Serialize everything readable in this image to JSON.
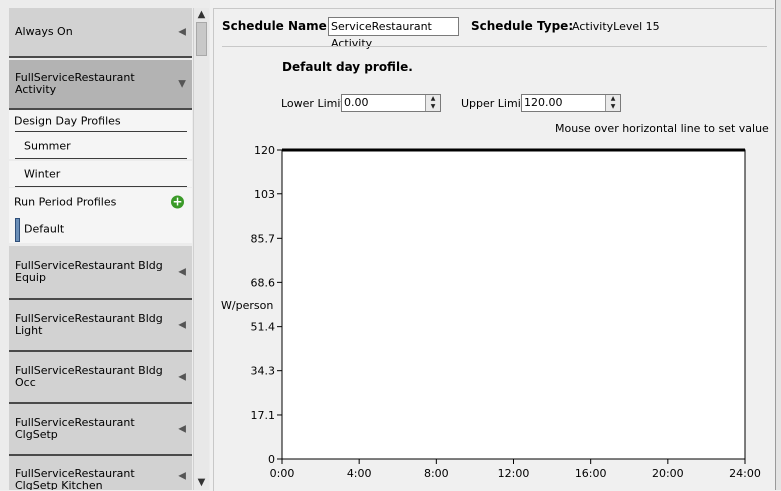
{
  "sidebar": {
    "items_top": [
      {
        "label": "Always On"
      },
      {
        "label": "FullServiceRestaurant Activity"
      }
    ],
    "design_day_header": "Design Day Profiles",
    "design_days": [
      "Summer",
      "Winter"
    ],
    "run_period_header": "Run Period Profiles",
    "run_period_default": "Default",
    "items_bottom": [
      {
        "label": "FullServiceRestaurant Bldg Equip"
      },
      {
        "label": "FullServiceRestaurant Bldg Light"
      },
      {
        "label": "FullServiceRestaurant Bldg Occ"
      },
      {
        "label": "FullServiceRestaurant ClgSetp"
      },
      {
        "label": "FullServiceRestaurant ClgSetp Kitchen"
      }
    ],
    "arrow_collapsed": "◀",
    "arrow_expanded": "▼",
    "add_icon": "plus-circle-icon"
  },
  "main": {
    "schedule_name_label": "Schedule Name:",
    "schedule_name_value": "ServiceRestaurant Activity",
    "schedule_type_label": "Schedule Type:",
    "schedule_type_value": "ActivityLevel 15",
    "profile_title": "Default day profile.",
    "lower_limit_label": "Lower Limit:",
    "lower_limit_value": "0.00",
    "upper_limit_label": "Upper Limit:",
    "upper_limit_value": "120.00",
    "hint": "Mouse over horizontal line to set value"
  },
  "chart_data": {
    "type": "line",
    "ylabel": "W/person",
    "xlabel": "",
    "yticks": [
      "0",
      "17.1",
      "34.3",
      "51.4",
      "68.6",
      "85.7",
      "103",
      "120"
    ],
    "ytick_values": [
      0,
      17.1,
      34.3,
      51.4,
      68.6,
      85.7,
      103,
      120
    ],
    "xticks": [
      "0:00",
      "4:00",
      "8:00",
      "12:00",
      "16:00",
      "20:00",
      "24:00"
    ],
    "xtick_values": [
      0,
      4,
      8,
      12,
      16,
      20,
      24
    ],
    "xlim": [
      0,
      24
    ],
    "ylim": [
      0,
      120
    ],
    "series": [
      {
        "x": [
          0,
          24
        ],
        "y": [
          120,
          120
        ]
      }
    ],
    "colors": {
      "line": "#000000"
    }
  }
}
